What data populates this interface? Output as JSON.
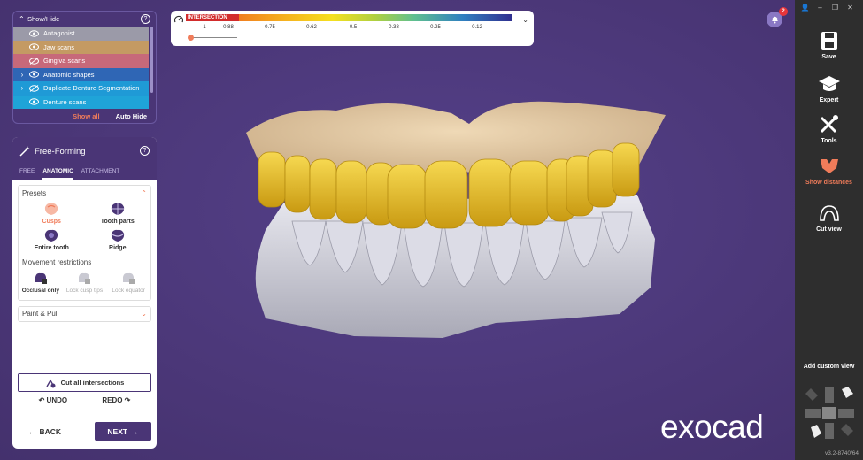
{
  "colorbar": {
    "intersection_label": "INTERSECTION",
    "ticks": [
      "-1",
      "-0.88",
      "-0.75",
      "-0.62",
      "-0.5",
      "-0.38",
      "-0.25",
      "-0.12"
    ]
  },
  "show_hide": {
    "title": "Show/Hide",
    "items": [
      {
        "label": "Antagonist",
        "color": "#9b9aa8",
        "visible": true,
        "expandable": false
      },
      {
        "label": "Jaw scans",
        "color": "#c49a63",
        "visible": true,
        "expandable": false
      },
      {
        "label": "Gingiva scans",
        "color": "#c7697a",
        "visible": false,
        "expandable": false
      },
      {
        "label": "Anatomic shapes",
        "color": "#2f66b5",
        "visible": true,
        "expandable": true
      },
      {
        "label": "Duplicate Denture Segmentation",
        "color": "#1f9ad6",
        "visible": false,
        "expandable": true
      },
      {
        "label": "Denture scans",
        "color": "#1fa4d8",
        "visible": true,
        "expandable": false
      }
    ],
    "show_all": "Show all",
    "auto_hide": "Auto Hide"
  },
  "free_forming": {
    "title": "Free-Forming",
    "tabs": [
      "FREE",
      "ANATOMIC",
      "ATTACHMENT"
    ],
    "active_tab": "ANATOMIC",
    "presets_title": "Presets",
    "presets": [
      "Cusps",
      "Tooth parts",
      "Entire tooth",
      "Ridge"
    ],
    "selected_preset": "Cusps",
    "movement_title": "Movement restrictions",
    "movement": [
      {
        "label": "Occlusal only",
        "enabled": true
      },
      {
        "label": "Lock cusp tips",
        "enabled": false
      },
      {
        "label": "Lock equator",
        "enabled": false
      }
    ],
    "paint_pull": "Paint & Pull",
    "cut_button": "Cut all intersections",
    "undo": "UNDO",
    "redo": "REDO",
    "back": "BACK",
    "next": "NEXT"
  },
  "notifications": {
    "count": "2"
  },
  "logo": "exocad",
  "toolbar": {
    "items": [
      {
        "label": "Save",
        "icon": "save-icon",
        "active": false
      },
      {
        "label": "Expert",
        "icon": "graduation-cap-icon",
        "active": false
      },
      {
        "label": "Tools",
        "icon": "tools-icon",
        "active": false
      },
      {
        "label": "Show distances",
        "icon": "distance-icon",
        "active": true
      },
      {
        "label": "Cut view",
        "icon": "cut-view-icon",
        "active": false
      }
    ],
    "add_custom_view": "Add custom view",
    "version": "v3.2-8740/64"
  },
  "colors": {
    "accent": "#f07c5a",
    "panel": "#4a3576",
    "background": "#4b3778",
    "toolbar": "#2e2e2e"
  }
}
